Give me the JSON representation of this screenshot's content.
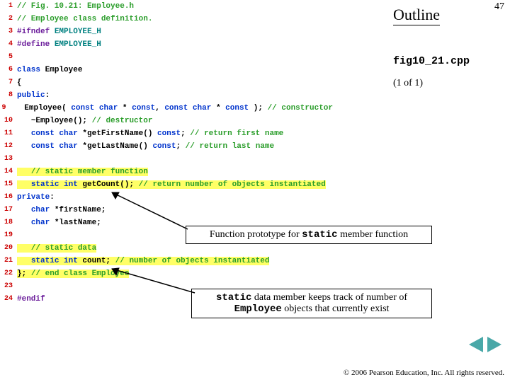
{
  "outline": {
    "title": "Outline",
    "pagenum": "47"
  },
  "file": {
    "name": "fig10_21.cpp",
    "pageof": "(1 of 1)"
  },
  "callouts": {
    "c1_pre": "Function prototype for ",
    "c1_code": "static",
    "c1_post": " member function",
    "c2_pre": "",
    "c2_code1": "static",
    "c2_mid": " data member keeps track of number of ",
    "c2_code2": "Employee",
    "c2_post": " objects that currently exist"
  },
  "copyright": "© 2006 Pearson Education, Inc. All rights reserved.",
  "lines": [
    {
      "n": "1",
      "segs": [
        {
          "t": "// Fig. 10.21: Employee.h",
          "cls": "comment"
        }
      ]
    },
    {
      "n": "2",
      "segs": [
        {
          "t": "// Employee class definition.",
          "cls": "comment"
        }
      ]
    },
    {
      "n": "3",
      "segs": [
        {
          "t": "#ifndef",
          "cls": "macro"
        },
        {
          "t": " ",
          "cls": ""
        },
        {
          "t": "EMPLOYEE_H",
          "cls": "teal"
        }
      ]
    },
    {
      "n": "4",
      "segs": [
        {
          "t": "#define",
          "cls": "macro"
        },
        {
          "t": " ",
          "cls": ""
        },
        {
          "t": "EMPLOYEE_H",
          "cls": "teal"
        }
      ]
    },
    {
      "n": "5",
      "segs": []
    },
    {
      "n": "6",
      "segs": [
        {
          "t": "class",
          "cls": "keyword"
        },
        {
          "t": " ",
          "cls": ""
        },
        {
          "t": "Employee",
          "cls": "ident"
        }
      ]
    },
    {
      "n": "7",
      "segs": [
        {
          "t": "{",
          "cls": "punc"
        }
      ]
    },
    {
      "n": "8",
      "segs": [
        {
          "t": "public",
          "cls": "keyword"
        },
        {
          "t": ":",
          "cls": "punc"
        }
      ]
    },
    {
      "n": "9",
      "indent": 1,
      "segs": [
        {
          "t": "Employee( ",
          "cls": "ident"
        },
        {
          "t": "const char",
          "cls": "keyword"
        },
        {
          "t": " * ",
          "cls": "ident"
        },
        {
          "t": "const",
          "cls": "keyword"
        },
        {
          "t": ", ",
          "cls": "punc"
        },
        {
          "t": "const char",
          "cls": "keyword"
        },
        {
          "t": " * ",
          "cls": "ident"
        },
        {
          "t": "const",
          "cls": "keyword"
        },
        {
          "t": " ); ",
          "cls": "punc"
        },
        {
          "t": "// constructor",
          "cls": "comment"
        }
      ]
    },
    {
      "n": "10",
      "indent": 1,
      "segs": [
        {
          "t": "~Employee(); ",
          "cls": "ident"
        },
        {
          "t": "// destructor",
          "cls": "comment"
        }
      ]
    },
    {
      "n": "11",
      "indent": 1,
      "segs": [
        {
          "t": "const char",
          "cls": "keyword"
        },
        {
          "t": " *getFirstName() ",
          "cls": "ident"
        },
        {
          "t": "const",
          "cls": "keyword"
        },
        {
          "t": "; ",
          "cls": "punc"
        },
        {
          "t": "// return first name",
          "cls": "comment"
        }
      ]
    },
    {
      "n": "12",
      "indent": 1,
      "segs": [
        {
          "t": "const char",
          "cls": "keyword"
        },
        {
          "t": " *getLastName() ",
          "cls": "ident"
        },
        {
          "t": "const",
          "cls": "keyword"
        },
        {
          "t": "; ",
          "cls": "punc"
        },
        {
          "t": "// return last name",
          "cls": "comment"
        }
      ]
    },
    {
      "n": "13",
      "segs": []
    },
    {
      "n": "14",
      "indent": 1,
      "hl": true,
      "segs": [
        {
          "t": "// static member function",
          "cls": "comment"
        }
      ]
    },
    {
      "n": "15",
      "indent": 1,
      "hl": true,
      "segs": [
        {
          "t": "static int",
          "cls": "keyword"
        },
        {
          "t": " getCount(); ",
          "cls": "ident"
        },
        {
          "t": "// return number of objects instantiated",
          "cls": "comment"
        }
      ]
    },
    {
      "n": "16",
      "segs": [
        {
          "t": "private",
          "cls": "keyword"
        },
        {
          "t": ":",
          "cls": "punc"
        }
      ]
    },
    {
      "n": "17",
      "indent": 1,
      "segs": [
        {
          "t": "char",
          "cls": "keyword"
        },
        {
          "t": " *firstName;",
          "cls": "ident"
        }
      ]
    },
    {
      "n": "18",
      "indent": 1,
      "segs": [
        {
          "t": "char",
          "cls": "keyword"
        },
        {
          "t": " *lastName;",
          "cls": "ident"
        }
      ]
    },
    {
      "n": "19",
      "segs": []
    },
    {
      "n": "20",
      "indent": 1,
      "hl": true,
      "segs": [
        {
          "t": "// static data",
          "cls": "comment"
        }
      ]
    },
    {
      "n": "21",
      "indent": 1,
      "hl": true,
      "segs": [
        {
          "t": "static int",
          "cls": "keyword"
        },
        {
          "t": " count; ",
          "cls": "ident"
        },
        {
          "t": "// number of objects instantiated",
          "cls": "comment"
        }
      ]
    },
    {
      "n": "22",
      "hl": true,
      "segs": [
        {
          "t": "}; ",
          "cls": "punc"
        },
        {
          "t": "// end class Employee",
          "cls": "comment"
        }
      ]
    },
    {
      "n": "23",
      "segs": []
    },
    {
      "n": "24",
      "segs": [
        {
          "t": "#endif",
          "cls": "macro"
        }
      ]
    }
  ]
}
